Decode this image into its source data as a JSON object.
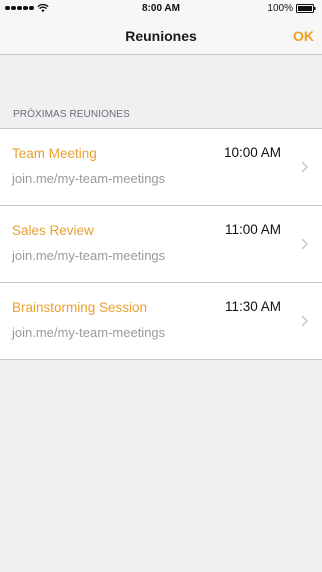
{
  "status_bar": {
    "time": "8:00 AM",
    "battery": "100%"
  },
  "nav": {
    "title": "Reuniones",
    "ok_label": "OK"
  },
  "section": {
    "header": "PRÓXIMAS REUNIONES"
  },
  "meetings": [
    {
      "title": "Team Meeting",
      "time": "10:00 AM",
      "link": "join.me/my-team-meetings"
    },
    {
      "title": "Sales Review",
      "time": "11:00 AM",
      "link": "join.me/my-team-meetings"
    },
    {
      "title": "Brainstorming Session",
      "time": "11:30 AM",
      "link": "join.me/my-team-meetings"
    }
  ],
  "colors": {
    "accent": "#f0a020",
    "background": "#f0f0f3",
    "secondary_text": "#9a9a9e"
  },
  "icons": {
    "signal": "signal-dots-icon",
    "wifi": "wifi-icon",
    "battery": "battery-icon",
    "row_chevron": "chevron-right-icon"
  }
}
